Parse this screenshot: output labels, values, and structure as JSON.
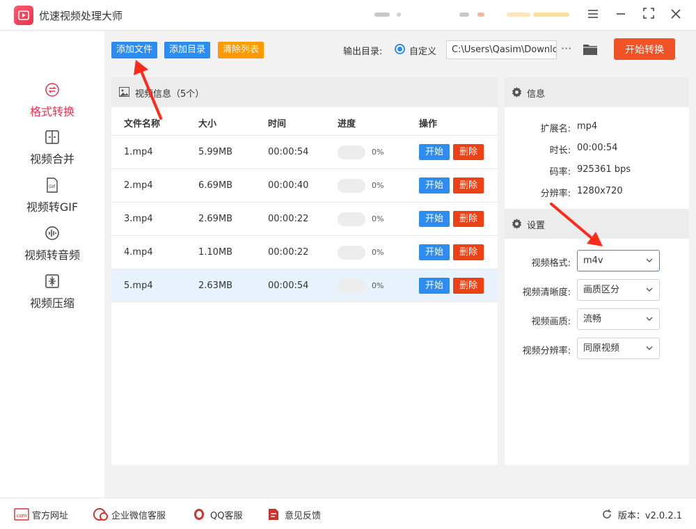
{
  "app": {
    "title": "优速视频处理大师"
  },
  "window_controls": [
    "menu-icon",
    "minimize-icon",
    "maximize-icon",
    "close-icon"
  ],
  "sidebar": {
    "items": [
      {
        "label": "格式转换",
        "icon": "format-convert-icon",
        "active": true
      },
      {
        "label": "视频合并",
        "icon": "merge-icon",
        "active": false
      },
      {
        "label": "视频转GIF",
        "icon": "gif-icon",
        "active": false
      },
      {
        "label": "视频转音频",
        "icon": "audio-icon",
        "active": false
      },
      {
        "label": "视频压缩",
        "icon": "compress-icon",
        "active": false
      }
    ]
  },
  "toolbar": {
    "add_file": "添加文件",
    "add_dir": "添加目录",
    "clear_list": "清除列表",
    "output_label": "输出目录:",
    "custom_label": "自定义",
    "output_path": "C:\\Users\\Qasim\\Downlo",
    "more": "···",
    "start_convert": "开始转换"
  },
  "file_panel": {
    "title": "视频信息（5个）",
    "columns": [
      "文件名称",
      "大小",
      "时间",
      "进度",
      "操作"
    ],
    "rows": [
      {
        "name": "1.mp4",
        "size": "5.99MB",
        "time": "00:00:54",
        "progress": "0%",
        "start": "开始",
        "delete": "删除"
      },
      {
        "name": "2.mp4",
        "size": "6.69MB",
        "time": "00:00:40",
        "progress": "0%",
        "start": "开始",
        "delete": "删除"
      },
      {
        "name": "3.mp4",
        "size": "2.69MB",
        "time": "00:00:22",
        "progress": "0%",
        "start": "开始",
        "delete": "删除"
      },
      {
        "name": "4.mp4",
        "size": "1.10MB",
        "time": "00:00:22",
        "progress": "0%",
        "start": "开始",
        "delete": "删除"
      },
      {
        "name": "5.mp4",
        "size": "2.63MB",
        "time": "00:00:54",
        "progress": "0%",
        "start": "开始",
        "delete": "删除"
      }
    ]
  },
  "info": {
    "title": "信息",
    "fields": [
      {
        "key": "扩展名:",
        "value": "mp4"
      },
      {
        "key": "时长:",
        "value": "00:00:54"
      },
      {
        "key": "码率:",
        "value": "925361 bps"
      },
      {
        "key": "分辨率:",
        "value": "1280x720"
      }
    ]
  },
  "settings": {
    "title": "设置",
    "fields": [
      {
        "key": "视频格式:",
        "value": "m4v"
      },
      {
        "key": "视频清晰度:",
        "value": "画质区分"
      },
      {
        "key": "视频画质:",
        "value": "流畅"
      },
      {
        "key": "视频分辨率:",
        "value": "同原视频"
      }
    ]
  },
  "footer": {
    "website": "官方网址",
    "wechat": "企业微信客服",
    "qq": "QQ客服",
    "feedback": "意见反馈",
    "version": "版本：v2.0.2.1"
  },
  "colors": {
    "accent_red": "#e8344e",
    "blue": "#2d8cf0",
    "orange": "#ff9900",
    "convert": "#f05125",
    "delete": "#ed4014"
  }
}
